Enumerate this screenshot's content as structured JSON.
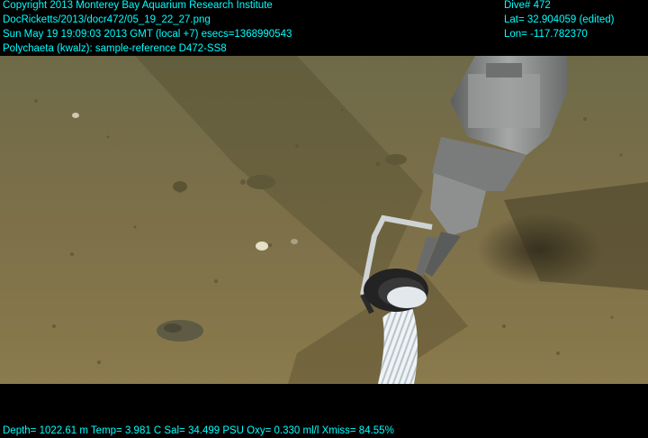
{
  "overlay": {
    "left_lines": [
      "Copyright 2013 Monterey Bay Aquarium Research Institute",
      "DocRicketts/2013/docr472/05_19_22_27.png",
      "Sun May 19 19:09:03 2013 GMT (local +7)  esecs=1368990543",
      "Polychaeta (kwalz): sample-reference D472-SS8"
    ],
    "right_lines": [
      "Dive# 472",
      "Lat= 32.904059 (edited)",
      "Lon= -117.782370"
    ],
    "telemetry": "Depth= 1022.61 m  Temp= 3.981 C  Sal= 34.499 PSU  Oxy= 0.330 ml/l  Xmiss= 84.55%"
  },
  "colors": {
    "overlay_text": "#00ffff",
    "seafloor": "#7a6e44",
    "seafloor_dark": "#4e472b",
    "hose": "#e8eef2",
    "arm_metal": "#8a8c8c"
  }
}
